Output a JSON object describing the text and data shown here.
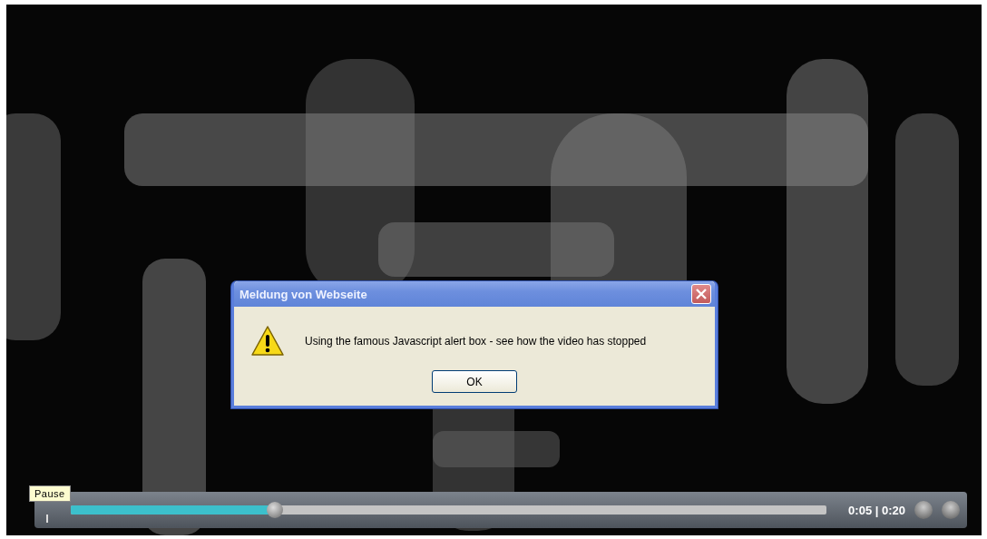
{
  "dialog": {
    "title": "Meldung von Webseite",
    "message": "Using the famous Javascript alert box - see how the video has stopped",
    "buttons": [
      "OK"
    ]
  },
  "player": {
    "tooltip": "Pause",
    "progress": {
      "level": 0.27
    },
    "time": "0:05 | 0:20"
  }
}
